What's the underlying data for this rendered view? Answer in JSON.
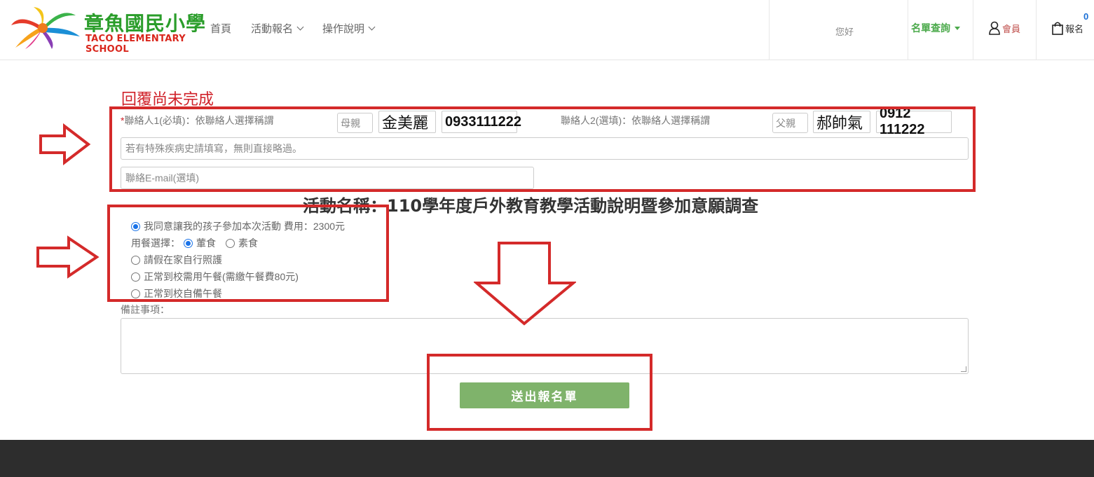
{
  "header": {
    "logo": {
      "title": "章魚國民小學",
      "subtitle": "TACO ELEMENTARY SCHOOL",
      "icon": "octopus-logo-icon"
    },
    "nav": [
      {
        "label": "首頁",
        "dropdown": false
      },
      {
        "label": "活動報名",
        "dropdown": true
      },
      {
        "label": "操作說明",
        "dropdown": true
      }
    ],
    "greeting": "您好",
    "query_label": "名單查詢",
    "member_label": "會員",
    "cart_label": "報名",
    "cart_count": "0"
  },
  "form": {
    "warning": "回覆尚未完成",
    "contact1": {
      "required_mark": "*",
      "label": "聯絡人1(必填)：依聯絡人選擇稱謂",
      "relation": "母親",
      "name": "金美麗",
      "phone": "0933111222"
    },
    "contact2": {
      "label": "聯絡人2(選填)：依聯絡人選擇稱謂",
      "relation": "父親",
      "name": "郝帥氣",
      "phone": "0912 111222"
    },
    "medical_placeholder": "若有特殊疾病史請填寫，無則直接略過。",
    "email_placeholder": "聯絡E-mail(選填)",
    "event_title": "活動名稱：110學年度戶外教育教學活動說明暨參加意願調查",
    "options": {
      "agree": "我同意讓我的孩子參加本次活動  費用：2300元",
      "meal_label": "用餐選擇：",
      "meal_meat": "葷食",
      "meal_veg": "素食",
      "leave": "請假在家自行照護",
      "school_lunch": "正常到校需用午餐(需繳午餐費80元)",
      "own_lunch": "正常到校自備午餐"
    },
    "notes_label": "備註事項：",
    "submit_label": "送出報名單"
  },
  "colors": {
    "accent_red": "#d42a2a",
    "submit_green": "#7fb36b",
    "brand_green": "#2a9d2a"
  }
}
